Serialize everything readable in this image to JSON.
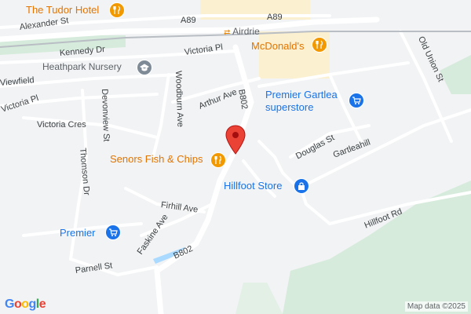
{
  "map": {
    "colors": {
      "land": "#f1f3f4",
      "road": "#ffffff",
      "major_road": "#ffffff",
      "park": "#d9ede1",
      "commercial": "#fdf0d0",
      "water": "#aadaff",
      "rail": "#b8bdc3"
    },
    "pois": [
      {
        "id": "tudor-hotel",
        "label": "The Tudor Hotel",
        "kind": "restaurant",
        "color": "orange",
        "icon": "fork-knife-icon"
      },
      {
        "id": "mcdonalds",
        "label": "McDonald's",
        "kind": "restaurant",
        "color": "orange",
        "icon": "fork-knife-icon"
      },
      {
        "id": "heathpark-nursery",
        "label": "Heathpark Nursery",
        "kind": "school",
        "color": "gray",
        "icon": "school-icon"
      },
      {
        "id": "premier-gartlea",
        "label_line1": "Premier Gartlea",
        "label_line2": "superstore",
        "kind": "shop",
        "color": "blue",
        "icon": "shopping-cart-icon"
      },
      {
        "id": "senors",
        "label": "Senors Fish & Chips",
        "kind": "restaurant",
        "color": "orange",
        "icon": "fork-knife-icon"
      },
      {
        "id": "hillfoot-store",
        "label": "Hillfoot Store",
        "kind": "shop",
        "color": "blue",
        "icon": "shopping-bag-icon"
      },
      {
        "id": "premier",
        "label": "Premier",
        "kind": "shop",
        "color": "blue",
        "icon": "shopping-cart-icon"
      }
    ],
    "station": {
      "label": "Airdrie",
      "icon": "train-icon"
    },
    "roads": {
      "a89_left": "A89",
      "a89_right": "A89",
      "alexander": "Alexander St",
      "kennedy": "Kennedy Dr",
      "victoria_pl_top": "Victoria Pl",
      "viewfield": "Viewfield",
      "victoria_pl_left": "Victoria Pl",
      "victoria_cres": "Victoria Cres",
      "devonview": "Devonview St",
      "woodburn": "Woodburn Ave",
      "arthur": "Arthur Ave",
      "b802_top": "B802",
      "b802_bottom": "B802",
      "thomson": "Thomson Dr",
      "douglas": "Douglas St",
      "gartleahill": "Gartleahill",
      "old_union": "Old Union St",
      "firhill": "Firhill Ave",
      "faskine": "Faskine Ave",
      "hillfoot_rd": "Hillfoot Rd",
      "parnell": "Parnell St"
    },
    "marker": {
      "color": "#ea4335",
      "icon": "map-pin-icon"
    },
    "logo": "Google",
    "attribution": "Map data ©2025"
  }
}
